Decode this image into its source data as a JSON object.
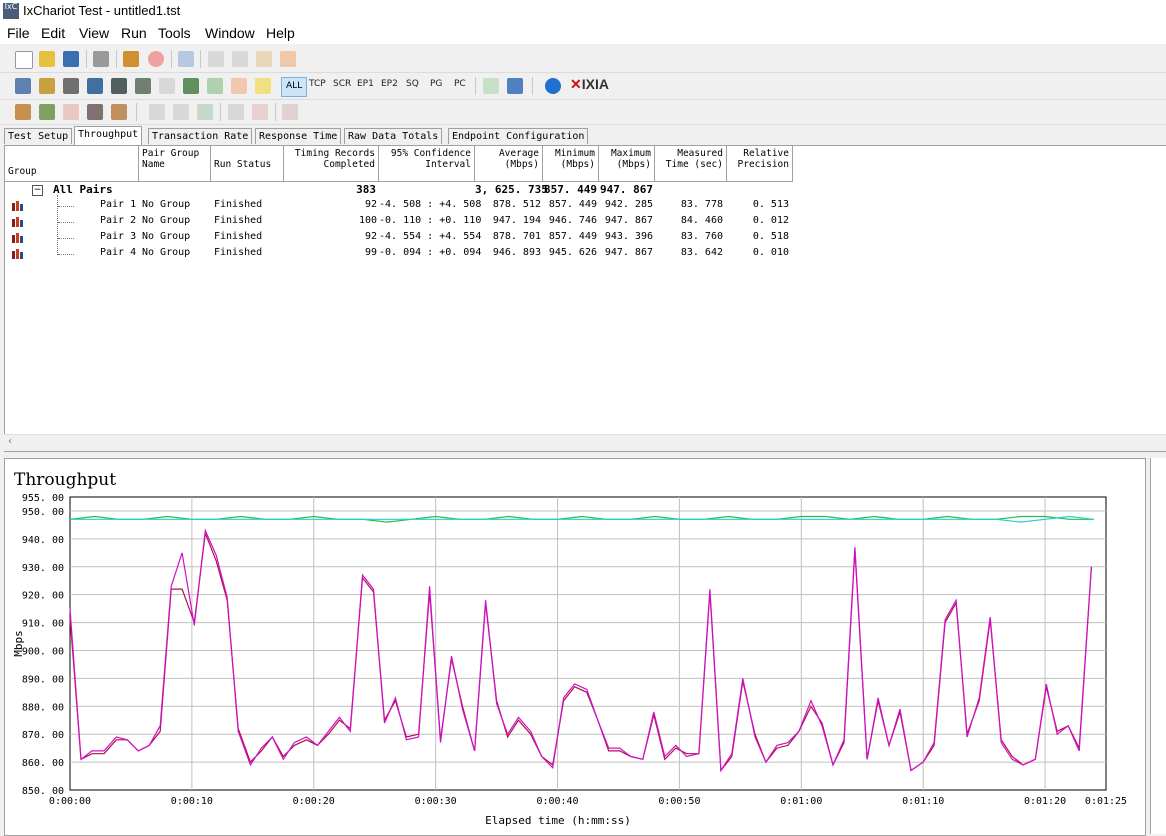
{
  "window": {
    "title": "IxChariot Test - untitled1.tst",
    "icon_text": "IxC"
  },
  "menu": [
    "File",
    "Edit",
    "View",
    "Run",
    "Tools",
    "Window",
    "Help"
  ],
  "toolbar2": {
    "filters": [
      "ALL",
      "TCP",
      "SCR",
      "EP1",
      "EP2",
      "SQ",
      "PG",
      "PC"
    ],
    "brand": "IXIA"
  },
  "tabs": [
    "Test Setup",
    "Throughput",
    "Transaction Rate",
    "Response Time",
    "Raw Data Totals",
    "Endpoint Configuration"
  ],
  "active_tab": "Throughput",
  "grid": {
    "headers": {
      "group": "Group",
      "pair_group_name": [
        "Pair Group",
        "Name"
      ],
      "run_status": "Run Status",
      "timing_records": [
        "Timing Records",
        "Completed"
      ],
      "confidence": [
        "95% Confidence",
        "Interval"
      ],
      "average": [
        "Average",
        "(Mbps)"
      ],
      "minimum": [
        "Minimum",
        "(Mbps)"
      ],
      "maximum": [
        "Maximum",
        "(Mbps)"
      ],
      "measured_time": [
        "Measured",
        "Time (sec)"
      ],
      "relative_precision": [
        "Relative",
        "Precision"
      ]
    },
    "all_pairs": {
      "label": "All Pairs",
      "records": "383",
      "average": "3, 625. 735",
      "minimum": "857. 449",
      "maximum": "947. 867"
    },
    "rows": [
      {
        "pair": "Pair 1",
        "group": "No Group",
        "status": "Finished",
        "records": "92",
        "ci": "-4. 508 : +4. 508",
        "average": "878. 512",
        "minimum": "857. 449",
        "maximum": "942. 285",
        "time": "83. 778",
        "precision": "0. 513"
      },
      {
        "pair": "Pair 2",
        "group": "No Group",
        "status": "Finished",
        "records": "100",
        "ci": "-0. 110 : +0. 110",
        "average": "947. 194",
        "minimum": "946. 746",
        "maximum": "947. 867",
        "time": "84. 460",
        "precision": "0. 012"
      },
      {
        "pair": "Pair 3",
        "group": "No Group",
        "status": "Finished",
        "records": "92",
        "ci": "-4. 554 : +4. 554",
        "average": "878. 701",
        "minimum": "857. 449",
        "maximum": "943. 396",
        "time": "83. 760",
        "precision": "0. 518"
      },
      {
        "pair": "Pair 4",
        "group": "No Group",
        "status": "Finished",
        "records": "99",
        "ci": "-0. 094 : +0. 094",
        "average": "946. 893",
        "minimum": "945. 626",
        "maximum": "947. 867",
        "time": "83. 642",
        "precision": "0. 010"
      }
    ]
  },
  "chart_data": {
    "type": "line",
    "title": "Throughput",
    "xlabel": "Elapsed time (h:mm:ss)",
    "ylabel": "Mbps",
    "ylim": [
      850,
      955
    ],
    "xlim": [
      0,
      85
    ],
    "yticks": [
      "850. 00",
      "860. 00",
      "870. 00",
      "880. 00",
      "890. 00",
      "900. 00",
      "910. 00",
      "920. 00",
      "930. 00",
      "940. 00",
      "950. 00",
      "955. 00"
    ],
    "xticks": [
      "0:00:00",
      "0:00:10",
      "0:00:20",
      "0:00:30",
      "0:00:40",
      "0:00:50",
      "0:01:00",
      "0:01:10",
      "0:01:20",
      "0:01:25"
    ],
    "grid": true,
    "series": [
      {
        "color": "#b0104a",
        "x": [
          0,
          0.9,
          1.8,
          2.8,
          3.8,
          4.7,
          5.6,
          6.5,
          7.4,
          8.3,
          9.2,
          10.2,
          11.1,
          12.0,
          12.9,
          13.8,
          14.8,
          15.7,
          16.6,
          17.5,
          18.4,
          19.4,
          20.3,
          21.2,
          22.1,
          23.0,
          24.0,
          24.9,
          25.8,
          26.7,
          27.6,
          28.6,
          29.5,
          30.4,
          31.3,
          32.2,
          33.2,
          34.1,
          35.0,
          35.9,
          36.8,
          37.8,
          38.7,
          39.6,
          40.5,
          41.4,
          42.4,
          43.3,
          44.2,
          45.1,
          46.0,
          47.0,
          47.9,
          48.8,
          49.7,
          50.6,
          51.6,
          52.5,
          53.4,
          54.3,
          55.2,
          56.2,
          57.1,
          58.0,
          58.9,
          59.8,
          60.8,
          61.7,
          62.6,
          63.5,
          64.4,
          65.4,
          66.3,
          67.2,
          68.1,
          69.0,
          70.0,
          70.9,
          71.8,
          72.7,
          73.6,
          74.6,
          75.5,
          76.4,
          77.3,
          78.2,
          79.2,
          80.1,
          81.0,
          81.9,
          82.8,
          83.8
        ],
        "y": [
          912,
          861,
          863,
          863,
          868,
          868,
          864,
          866,
          871,
          922,
          922,
          910,
          942,
          932,
          918,
          872,
          860,
          864,
          869,
          862,
          866,
          868,
          866,
          870,
          875,
          872,
          926,
          921,
          875,
          882,
          869,
          870,
          921,
          868,
          897,
          880,
          864,
          917,
          882,
          869,
          875,
          870,
          862,
          859,
          882,
          887,
          885,
          875,
          864,
          864,
          862,
          861,
          877,
          861,
          865,
          863,
          863,
          921,
          857,
          862,
          889,
          870,
          860,
          865,
          866,
          871,
          880,
          874,
          859,
          867,
          936,
          861,
          882,
          866,
          878,
          857,
          860,
          866,
          910,
          917,
          870,
          882,
          911,
          868,
          862,
          859,
          861,
          887,
          871,
          873,
          865,
          930
        ]
      },
      {
        "color": "#d010c8",
        "x": [
          0,
          0.9,
          1.8,
          2.8,
          3.8,
          4.7,
          5.6,
          6.5,
          7.4,
          8.3,
          9.2,
          10.2,
          11.1,
          12.0,
          12.9,
          13.8,
          14.8,
          15.7,
          16.6,
          17.5,
          18.4,
          19.4,
          20.3,
          21.2,
          22.1,
          23.0,
          24.0,
          24.9,
          25.8,
          26.7,
          27.6,
          28.6,
          29.5,
          30.4,
          31.3,
          32.2,
          33.2,
          34.1,
          35.0,
          35.9,
          36.8,
          37.8,
          38.7,
          39.6,
          40.5,
          41.4,
          42.4,
          43.3,
          44.2,
          45.1,
          46.0,
          47.0,
          47.9,
          48.8,
          49.7,
          50.6,
          51.6,
          52.5,
          53.4,
          54.3,
          55.2,
          56.2,
          57.1,
          58.0,
          58.9,
          59.8,
          60.8,
          61.7,
          62.6,
          63.5,
          64.4,
          65.4,
          66.3,
          67.2,
          68.1,
          69.0,
          70.0,
          70.9,
          71.8,
          72.7,
          73.6,
          74.6,
          75.5,
          76.4,
          77.3,
          78.2,
          79.2,
          80.1,
          81.0,
          81.9,
          82.8,
          83.8
        ],
        "y": [
          915,
          861,
          864,
          864,
          869,
          868,
          864,
          866,
          873,
          923,
          935,
          909,
          943,
          934,
          919,
          871,
          859,
          865,
          869,
          861,
          867,
          869,
          866,
          871,
          876,
          871,
          927,
          922,
          874,
          883,
          868,
          869,
          923,
          867,
          898,
          879,
          864,
          918,
          881,
          870,
          876,
          871,
          862,
          858,
          883,
          888,
          886,
          875,
          865,
          865,
          862,
          861,
          878,
          862,
          866,
          862,
          863,
          922,
          857,
          863,
          890,
          869,
          860,
          866,
          867,
          871,
          882,
          873,
          859,
          868,
          937,
          861,
          883,
          866,
          879,
          857,
          860,
          867,
          911,
          918,
          869,
          883,
          912,
          867,
          861,
          859,
          861,
          888,
          870,
          873,
          864,
          930
        ]
      },
      {
        "color": "#22c040",
        "x": [
          0,
          2,
          4,
          6,
          8,
          10,
          12,
          14,
          16,
          18,
          20,
          22,
          24,
          26,
          28,
          30,
          32,
          34,
          36,
          38,
          40,
          42,
          44,
          46,
          48,
          50,
          52,
          54,
          56,
          58,
          60,
          62,
          64,
          66,
          68,
          70,
          72,
          74,
          76,
          78,
          80,
          82,
          84
        ],
        "y": [
          947,
          948,
          947,
          947,
          948,
          947,
          947,
          948,
          947,
          947,
          948,
          947,
          947,
          946,
          947,
          948,
          947,
          947,
          948,
          947,
          947,
          948,
          947,
          947,
          948,
          947,
          947,
          948,
          947,
          947,
          948,
          948,
          947,
          948,
          947,
          947,
          948,
          947,
          947,
          948,
          948,
          947,
          947
        ]
      },
      {
        "color": "#20d0d0",
        "x": [
          0,
          2,
          4,
          6,
          8,
          10,
          12,
          14,
          16,
          18,
          20,
          22,
          24,
          26,
          28,
          30,
          32,
          34,
          36,
          38,
          40,
          42,
          44,
          46,
          48,
          50,
          52,
          54,
          56,
          58,
          60,
          62,
          64,
          66,
          68,
          70,
          72,
          74,
          76,
          78,
          80,
          82,
          84
        ],
        "y": [
          947,
          947,
          947,
          947,
          947,
          947,
          947,
          947,
          947,
          947,
          947,
          947,
          947,
          947,
          947,
          947,
          947,
          947,
          947,
          947,
          947,
          947,
          947,
          947,
          947,
          947,
          947,
          947,
          947,
          947,
          947,
          947,
          947,
          947,
          947,
          947,
          947,
          947,
          947,
          946,
          947,
          948,
          947
        ]
      }
    ]
  }
}
